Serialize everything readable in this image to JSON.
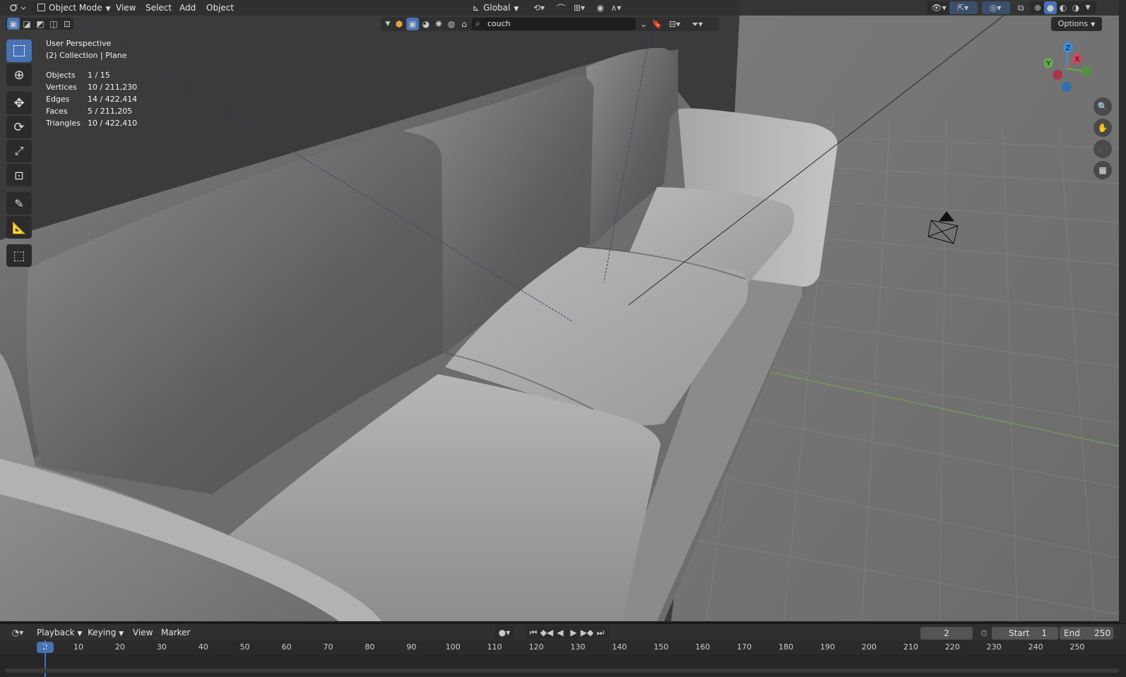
{
  "header": {
    "mode_label": "Object Mode",
    "menus": [
      "View",
      "Select",
      "Add",
      "Object"
    ],
    "transform_orientation": "Global",
    "search_value": "couch",
    "options_label": "Options"
  },
  "overlay": {
    "view_name": "User Perspective",
    "collection": "(2) Collection | Plane",
    "stats": [
      {
        "label": "Objects",
        "value": "1 / 15"
      },
      {
        "label": "Vertices",
        "value": "10 / 211,230"
      },
      {
        "label": "Edges",
        "value": "14 / 422,414"
      },
      {
        "label": "Faces",
        "value": "5 / 211,205"
      },
      {
        "label": "Triangles",
        "value": "10 / 422,410"
      }
    ]
  },
  "gizmo": {
    "z": "Z",
    "x": "X",
    "y": "Y"
  },
  "timeline": {
    "menus": [
      "Playback",
      "Keying",
      "View",
      "Marker"
    ],
    "current_frame": "2",
    "start_label": "Start",
    "start_value": "1",
    "end_label": "End",
    "end_value": "250",
    "ticks": [
      "10",
      "20",
      "30",
      "40",
      "50",
      "60",
      "70",
      "80",
      "90",
      "100",
      "110",
      "120",
      "130",
      "140",
      "150",
      "160",
      "170",
      "180",
      "190",
      "200",
      "210",
      "220",
      "230",
      "240",
      "250"
    ]
  },
  "colors": {
    "accent": "#4772b3",
    "header_bg": "#303030",
    "x_axis": "#d5435b",
    "y_axis": "#6aa84f",
    "z_axis": "#3d8ee0"
  }
}
